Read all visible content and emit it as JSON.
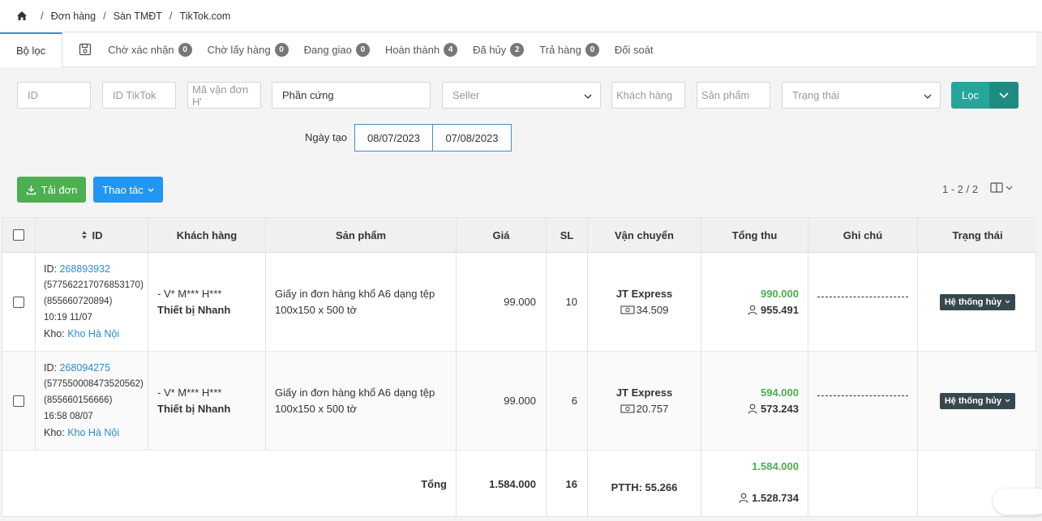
{
  "breadcrumb": {
    "items": [
      "Đơn hàng",
      "Sàn TMĐT",
      "TikTok.com"
    ]
  },
  "tabs": {
    "filter_label": "Bộ lọc",
    "items": [
      {
        "label": "Chờ xác nhận",
        "count": "0"
      },
      {
        "label": "Chờ lấy hàng",
        "count": "0"
      },
      {
        "label": "Đang giao",
        "count": "0"
      },
      {
        "label": "Hoàn thành",
        "count": "4"
      },
      {
        "label": "Đã hủy",
        "count": "2"
      },
      {
        "label": "Trả hàng",
        "count": "0"
      },
      {
        "label": "Đối soát",
        "count": null
      }
    ]
  },
  "filters": {
    "id_placeholder": "ID",
    "tiktok_placeholder": "ID TikTok",
    "tracking_placeholder": "Mã vận đơn H'",
    "keyword_value": "Phần cứng",
    "seller_placeholder": "Seller",
    "customer_placeholder": "Khách hàng",
    "product_placeholder": "Sản phẩm",
    "status_placeholder": "Trạng thái",
    "filter_button": "Lọc",
    "date_label": "Ngày tạo",
    "date_from": "08/07/2023",
    "date_to": "07/08/2023"
  },
  "actions": {
    "download_label": "Tải đơn",
    "actions_label": "Thao tác",
    "pager": "1 - 2 / 2"
  },
  "table": {
    "columns": [
      "ID",
      "Khách hàng",
      "Sản phẩm",
      "Giá",
      "SL",
      "Vận chuyển",
      "Tổng thu",
      "Ghi chú",
      "Trạng thái"
    ],
    "rows": [
      {
        "id_prefix": "ID:",
        "id": "268893932",
        "tiktok_id": "(577562217076853170)",
        "tracking": "(855660720894)",
        "time": "10:19 11/07",
        "warehouse_prefix": "Kho:",
        "warehouse": "Kho Hà Nội",
        "customer_name": "- V* M*** H***",
        "customer_company": "Thiết bị Nhanh",
        "product_line1": "Giấy in đơn hàng khổ A6 dạng tệp",
        "product_line2": "100x150 x 500 tờ",
        "price": "99.000",
        "qty": "10",
        "carrier": "JT Express",
        "ship_fee": "34.509",
        "total": "990.000",
        "net": "955.491",
        "status": "Hệ thống hủy"
      },
      {
        "id_prefix": "ID:",
        "id": "268094275",
        "tiktok_id": "(577550008473520562)",
        "tracking": "(855660156666)",
        "time": "16:58 08/07",
        "warehouse_prefix": "Kho:",
        "warehouse": "Kho Hà Nội",
        "customer_name": "- V* M*** H***",
        "customer_company": "Thiết bị Nhanh",
        "product_line1": "Giấy in đơn hàng khổ A6 dạng tệp",
        "product_line2": "100x150 x 500 tờ",
        "price": "99.000",
        "qty": "6",
        "carrier": "JT Express",
        "ship_fee": "20.757",
        "total": "594.000",
        "net": "573.243",
        "status": "Hệ thống hủy"
      }
    ],
    "summary": {
      "label": "Tổng",
      "price": "1.584.000",
      "qty": "16",
      "shipping": "PTTH: 55.266",
      "total": "1.584.000",
      "net": "1.528.734"
    }
  }
}
